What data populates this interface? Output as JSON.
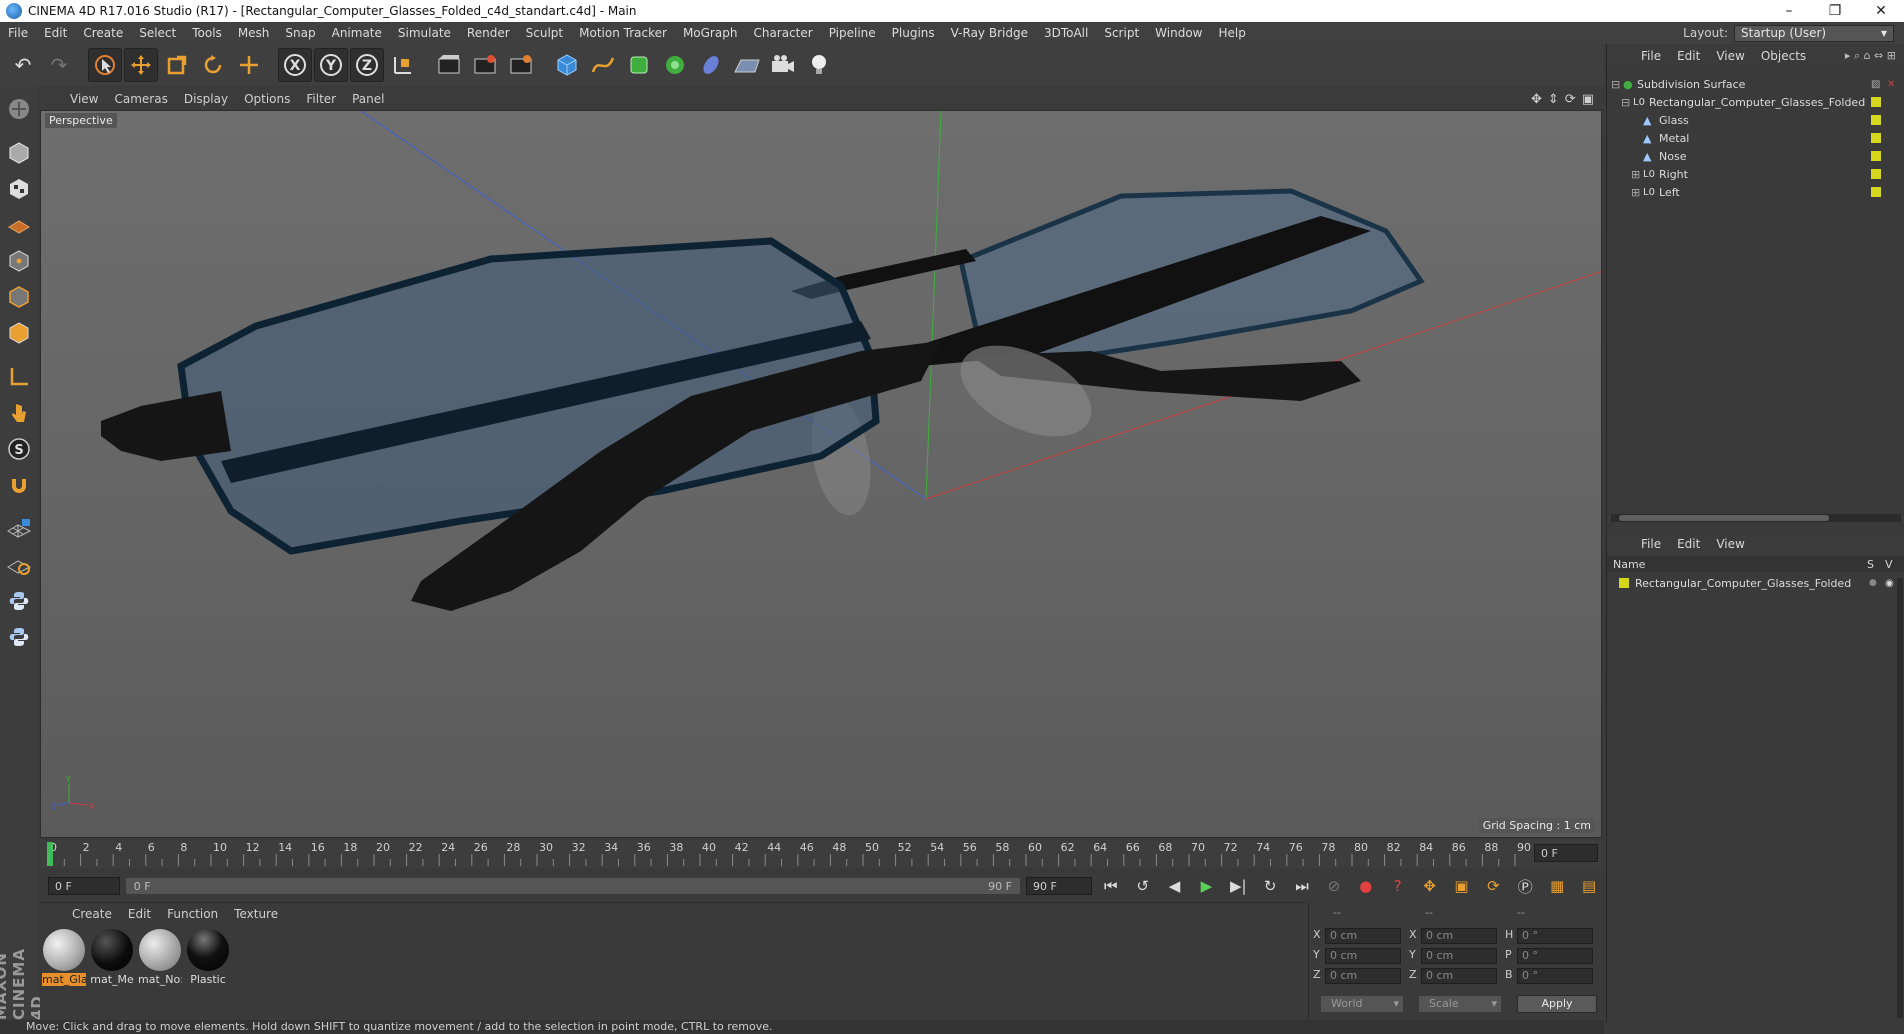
{
  "window": {
    "title": "CINEMA 4D R17.016 Studio (R17) - [Rectangular_Computer_Glasses_Folded_c4d_standart.c4d] - Main",
    "controls": [
      "–",
      "❐",
      "✕"
    ]
  },
  "menubar": {
    "items": [
      "File",
      "Edit",
      "Create",
      "Select",
      "Tools",
      "Mesh",
      "Snap",
      "Animate",
      "Simulate",
      "Render",
      "Sculpt",
      "Motion Tracker",
      "MoGraph",
      "Character",
      "Pipeline",
      "Plugins",
      "V-Ray Bridge",
      "3DToAll",
      "Script",
      "Window",
      "Help"
    ],
    "layout_label": "Layout:",
    "layout_value": "Startup (User)"
  },
  "toolbar": {
    "icons": [
      "undo-icon",
      "redo-icon",
      "live-selection-icon",
      "move-icon",
      "scale-icon",
      "rotate-icon",
      "recent-tools-icon",
      "x-axis-icon",
      "y-axis-icon",
      "z-axis-icon",
      "coordinate-system-icon",
      "render-view-icon",
      "render-picture-viewer-icon",
      "edit-render-settings-icon",
      "cube-primitive-icon",
      "spline-pen-icon",
      "subdivision-surface-icon",
      "cloner-icon",
      "deformer-icon",
      "floor-icon",
      "camera-icon",
      "light-icon"
    ],
    "axis_labels": [
      "X",
      "Y",
      "Z"
    ]
  },
  "left_tools": [
    "make-editable-icon",
    "model-mode-icon",
    "texture-mode-icon",
    "workplane-mode-icon",
    "points-mode-icon",
    "edges-mode-icon",
    "polygons-mode-icon",
    "axis-mode-icon",
    "tweak-mode-icon",
    "snap-icon",
    "magnet-icon",
    "grid-lock-icon",
    "sculpt-layer-icon",
    "python-icon",
    "python-script-icon"
  ],
  "viewport": {
    "menu": [
      "View",
      "Cameras",
      "Display",
      "Options",
      "Filter",
      "Panel"
    ],
    "label": "Perspective",
    "grid_spacing": "Grid Spacing : 1 cm",
    "axis_gizmo": [
      "Y",
      "Z",
      "X"
    ]
  },
  "timeline": {
    "ticks": [
      "0",
      "2",
      "4",
      "6",
      "8",
      "10",
      "12",
      "14",
      "16",
      "18",
      "20",
      "22",
      "24",
      "26",
      "28",
      "30",
      "32",
      "34",
      "36",
      "38",
      "40",
      "42",
      "44",
      "46",
      "48",
      "50",
      "52",
      "54",
      "56",
      "58",
      "60",
      "62",
      "64",
      "66",
      "68",
      "70",
      "72",
      "74",
      "76",
      "78",
      "80",
      "82",
      "84",
      "86",
      "88",
      "90"
    ],
    "current_frame_field": "0 F",
    "start_field": "0 F",
    "range_start": "0 F",
    "range_end": "90 F",
    "end_field": "90 F"
  },
  "materials": {
    "menu": [
      "Create",
      "Edit",
      "Function",
      "Texture"
    ],
    "items": [
      {
        "label": "mat_Gla",
        "active": true,
        "color": "#c8c8c8"
      },
      {
        "label": "mat_Me",
        "active": false,
        "color": "#111111"
      },
      {
        "label": "mat_No:",
        "active": false,
        "color": "#bdbdbd"
      },
      {
        "label": "Plastic",
        "active": false,
        "color": "#111111"
      }
    ]
  },
  "coordinates": {
    "header": [
      "--",
      "--",
      "--"
    ],
    "rows": [
      {
        "a": "X",
        "v1": "0 cm",
        "b": "X",
        "v2": "0 cm",
        "c": "H",
        "v3": "0 °"
      },
      {
        "a": "Y",
        "v1": "0 cm",
        "b": "Y",
        "v2": "0 cm",
        "c": "P",
        "v3": "0 °"
      },
      {
        "a": "Z",
        "v1": "0 cm",
        "b": "Z",
        "v2": "0 cm",
        "c": "B",
        "v3": "0 °"
      }
    ],
    "world": "World",
    "scale": "Scale",
    "apply": "Apply"
  },
  "status": "Move: Click and drag to move elements. Hold down SHIFT to quantize movement / add to the selection in point mode, CTRL to remove.",
  "object_manager": {
    "menu": [
      "File",
      "Edit",
      "View",
      "Objects"
    ],
    "tree": [
      {
        "label": "Subdivision Surface",
        "level": 0
      },
      {
        "label": "Rectangular_Computer_Glasses_Folded",
        "level": 1
      },
      {
        "label": "Glass",
        "level": 2
      },
      {
        "label": "Metal",
        "level": 2
      },
      {
        "label": "Nose",
        "level": 2
      },
      {
        "label": "Right",
        "level": 2
      },
      {
        "label": "Left",
        "level": 2
      }
    ]
  },
  "attribute_manager": {
    "menu": [
      "File",
      "Edit",
      "View"
    ],
    "col_name": "Name",
    "col_s": "S",
    "col_v": "V",
    "row": "Rectangular_Computer_Glasses_Folded"
  },
  "colors": {
    "accent_orange": "#e8902c",
    "object_yellow": "#d6d61a",
    "axis_red": "#c84040",
    "axis_green": "#3fae3f",
    "axis_blue": "#3f5fd0"
  }
}
